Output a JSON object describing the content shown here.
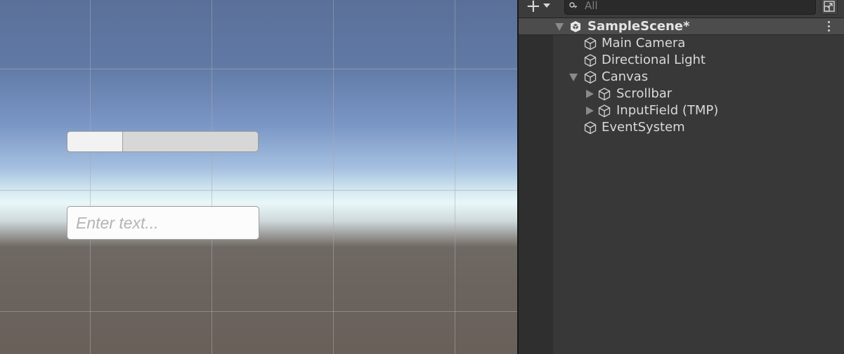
{
  "scene_view": {
    "scrollbar": {
      "handle_fraction": 0.29
    },
    "input_field": {
      "placeholder": "Enter text..."
    }
  },
  "hierarchy": {
    "search": {
      "placeholder": "All"
    },
    "scene": {
      "name": "SampleScene*"
    },
    "items": [
      {
        "label": "Main Camera",
        "icon": "gameobject-cube-icon"
      },
      {
        "label": "Directional Light",
        "icon": "gameobject-cube-icon"
      },
      {
        "label": "Canvas",
        "icon": "gameobject-cube-icon"
      },
      {
        "label": "Scrollbar",
        "icon": "gameobject-cube-icon"
      },
      {
        "label": "InputField (TMP)",
        "icon": "gameobject-cube-icon"
      },
      {
        "label": "EventSystem",
        "icon": "gameobject-cube-icon"
      }
    ]
  },
  "colors": {
    "panel_bg": "#383838",
    "scene_header_bg": "#4c4c4c",
    "text": "#d9d9d9"
  }
}
